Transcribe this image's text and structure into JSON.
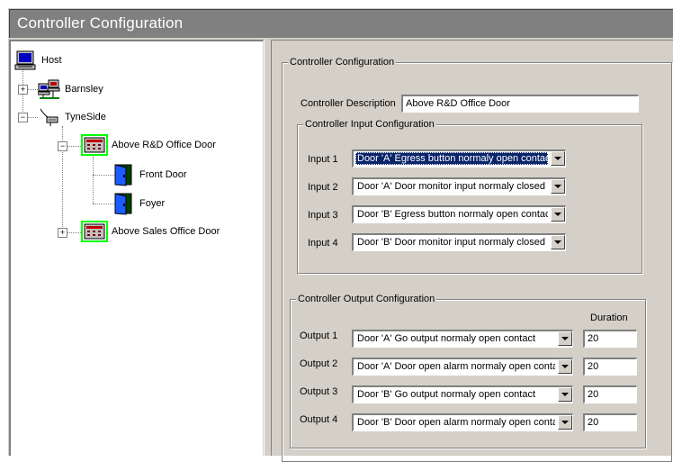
{
  "window": {
    "title": "Controller Configuration"
  },
  "tree": {
    "host": "Host",
    "barnsley": "Barnsley",
    "tyneside": "TyneSide",
    "controller1": "Above R&D Office Door",
    "door1": "Front Door",
    "door2": "Foyer",
    "controller2": "Above Sales Office Door"
  },
  "config": {
    "main_group": "Controller Configuration",
    "description_label": "Controller Description",
    "description_value": "Above R&D Office Door",
    "input_group": "Controller Input Configuration",
    "inputs": [
      {
        "label": "Input 1",
        "value": "Door 'A' Egress button normaly open contact"
      },
      {
        "label": "Input 2",
        "value": "Door 'A' Door monitor input normaly closed contact"
      },
      {
        "label": "Input 3",
        "value": "Door 'B' Egress button normaly open contact"
      },
      {
        "label": "Input 4",
        "value": "Door 'B' Door monitor input normaly closed contact"
      }
    ],
    "output_group": "Controller Output Configuration",
    "duration_header": "Duration",
    "outputs": [
      {
        "label": "Output 1",
        "value": "Door 'A' Go output normaly open contact",
        "duration": "20"
      },
      {
        "label": "Output 2",
        "value": "Door 'A' Door open alarm normaly open contact",
        "duration": "20"
      },
      {
        "label": "Output 3",
        "value": "Door 'B' Go output normaly open contact",
        "duration": "20"
      },
      {
        "label": "Output 4",
        "value": "Door 'B' Door open alarm normaly open contact",
        "duration": "20"
      }
    ]
  },
  "icons": {
    "host": "monitor-icon",
    "site": "network-computers-icon",
    "site2": "network-cable-icon",
    "controller": "keypad-controller-icon",
    "door": "door-icon",
    "expand": "plus-box-icon",
    "collapse": "minus-box-icon",
    "dropdown": "dropdown-arrow-icon"
  },
  "colors": {
    "selection": "#0a246a",
    "face": "#d4d0c8",
    "highlight_green": "#00ff00"
  }
}
